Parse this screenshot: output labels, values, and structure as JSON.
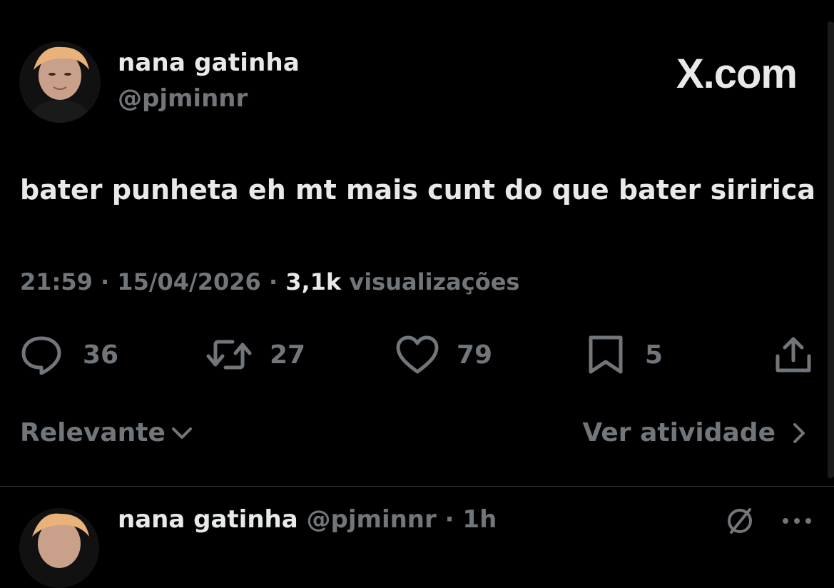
{
  "tweet": {
    "author": {
      "display_name": "nana gatinha",
      "handle": "@pjminnr"
    },
    "brand": "X.com",
    "text": "bater punheta eh mt mais cunt do que bater siririca",
    "time": "21:59",
    "separator": "·",
    "date": "15/04/2026",
    "views_count": "3,1k",
    "views_label": "visualizações",
    "actions": {
      "replies": "36",
      "reposts": "27",
      "likes": "79",
      "bookmarks": "5"
    }
  },
  "footer": {
    "sort_label": "Relevante",
    "activity_label": "Ver atividade"
  },
  "reply": {
    "display_name": "nana gatinha",
    "handle": "@pjminnr",
    "separator": "·",
    "time": "1h"
  },
  "icons": {
    "reply": "speech-bubble-icon",
    "repost": "repost-arrows-icon",
    "like": "heart-icon",
    "bookmark": "bookmark-icon",
    "share": "share-upload-icon",
    "sort": "chevron-down-icon",
    "activity": "chevron-right-icon",
    "grok": "grok-icon",
    "more": "more-dots-icon"
  },
  "colors": {
    "background": "#000000",
    "primary_text": "#e7e9ea",
    "secondary_text": "#71767b",
    "divider": "#2f3336"
  }
}
